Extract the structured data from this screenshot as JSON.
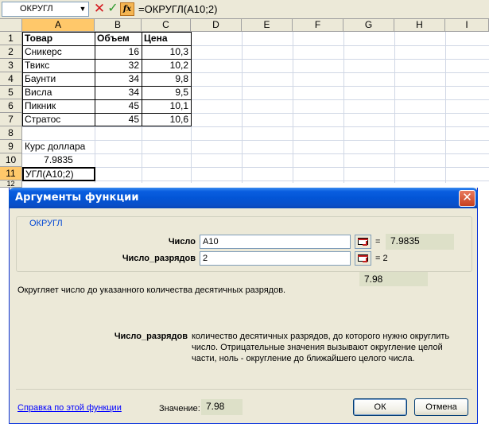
{
  "formula_bar": {
    "name_box": "ОКРУГЛ",
    "cancel_symbol": "✕",
    "enter_symbol": "✓",
    "fx_label": "fx",
    "formula": "=ОКРУГЛ(A10;2)"
  },
  "columns": [
    "A",
    "B",
    "C",
    "D",
    "E",
    "F",
    "G",
    "H",
    "I"
  ],
  "rows": [
    "1",
    "2",
    "3",
    "4",
    "5",
    "6",
    "7",
    "8",
    "9",
    "10",
    "11",
    "12"
  ],
  "table": {
    "headers": [
      "Товар",
      "Объем",
      "Цена"
    ],
    "rows": [
      [
        "Сникерс",
        "16",
        "10,3"
      ],
      [
        "Твикс",
        "32",
        "10,2"
      ],
      [
        "Баунти",
        "34",
        "9,8"
      ],
      [
        "Висла",
        "34",
        "9,5"
      ],
      [
        "Пикник",
        "45",
        "10,1"
      ],
      [
        "Стратос",
        "45",
        "10,6"
      ]
    ]
  },
  "cells": {
    "a9": "Курс доллара",
    "a10": "7.9835",
    "a11": "УГЛ(A10;2)"
  },
  "dialog": {
    "title": "Аргументы функции",
    "close_symbol": "✕",
    "function_name": "ОКРУГЛ",
    "args": [
      {
        "label": "Число",
        "value": "A10",
        "equals": "=",
        "result": "7.9835"
      },
      {
        "label": "Число_разрядов",
        "value": "2",
        "equals": "= 2",
        "result": ""
      }
    ],
    "result_preview": "7.98",
    "description": "Округляет число до указанного количества десятичных разрядов.",
    "arg_help_label": "Число_разрядов",
    "arg_help_text_1": "количество десятичных разрядов, до которого нужно округлить",
    "arg_help_text_2": "число. Отрицательные значения вызывают округление целой",
    "arg_help_text_3": "части, ноль - округление до ближайшего целого числа.",
    "help_link": "Справка по этой функции",
    "value_label": "Значение:",
    "value": "7.98",
    "ok_label": "ОК",
    "cancel_label": "Отмена"
  },
  "colors": {
    "title_blue": "#0355d6",
    "selected_header": "#ffc86a",
    "dialog_bg": "#ece9d8"
  }
}
